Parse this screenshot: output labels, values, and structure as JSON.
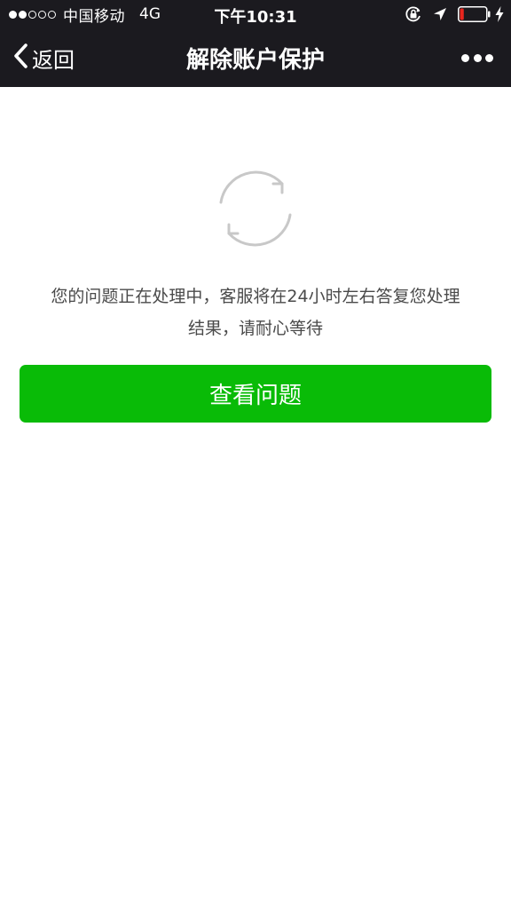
{
  "status_bar": {
    "signal": {
      "filled_dots": 2,
      "total_dots": 5
    },
    "carrier": "中国移动",
    "network": "4G",
    "time": "下午10:31",
    "battery_level": 0.15,
    "icons": [
      "orientation-lock-icon",
      "location-arrow-icon",
      "battery-icon",
      "charging-bolt-icon"
    ]
  },
  "nav": {
    "back_label": "返回",
    "title": "解除账户保护",
    "more_icon": "more-dots-icon"
  },
  "main": {
    "icon": "refresh-icon",
    "message_line1": "您的问题正在处理中，客服将在24小时左右答复您处理",
    "message_line2": "结果，请耐心等待",
    "button_label": "查看问题"
  },
  "colors": {
    "bar_bg": "#1b1a1f",
    "primary_green": "#09bb07",
    "icon_gray": "#c8c8c8",
    "battery_red": "#e8261e"
  }
}
